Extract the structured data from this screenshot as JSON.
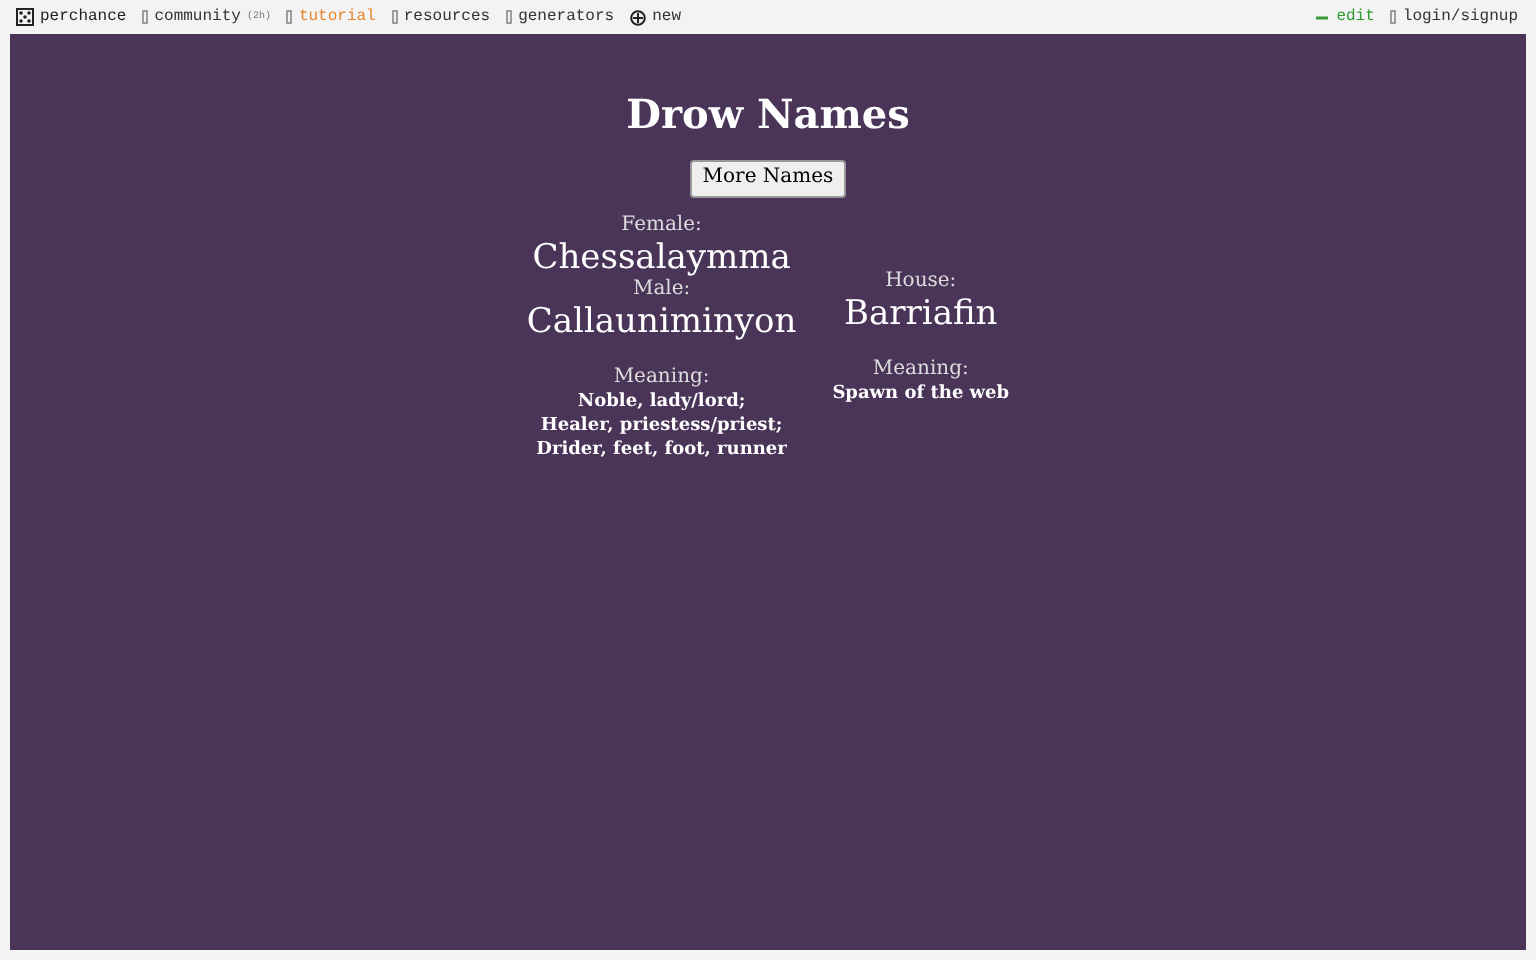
{
  "nav": {
    "left": [
      {
        "label": "perchance",
        "kind": "brand"
      },
      {
        "label": "community",
        "note": "(2h)",
        "kind": "link"
      },
      {
        "label": "tutorial",
        "kind": "highlight"
      },
      {
        "label": "resources",
        "kind": "link"
      },
      {
        "label": "generators",
        "kind": "link"
      },
      {
        "label": "new",
        "kind": "create"
      }
    ],
    "right": [
      {
        "label": "edit",
        "kind": "edit"
      },
      {
        "label": "login/signup",
        "kind": "link"
      }
    ]
  },
  "title": "Drow Names",
  "button": "More Names",
  "left_column": {
    "female_label": "Female:",
    "female_name": "Chessalaymma",
    "male_label": "Male:",
    "male_name": "Callauniminyon",
    "meaning_label": "Meaning:",
    "meaning_lines": [
      "Noble, lady/lord;",
      "Healer, priestess/priest;",
      "Drider, feet, foot, runner"
    ]
  },
  "right_column": {
    "house_label": "House:",
    "house_name": "Barriafin",
    "meaning_label": "Meaning:",
    "meaning_lines": [
      "Spawn of the web"
    ]
  }
}
